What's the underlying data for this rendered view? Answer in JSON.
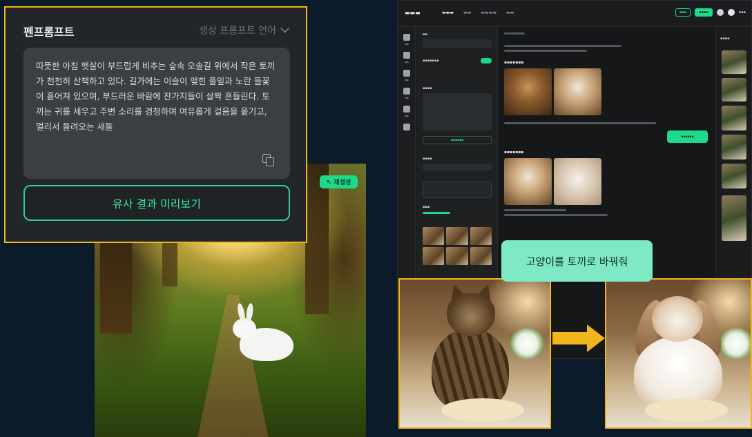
{
  "prompt_panel": {
    "title": "펜프롬프트",
    "dropdown_label": "생성 프롬프트 언어",
    "prompt_text": "따뜻한 아침 햇살이 부드럽게 비추는 숲속 오솔길 위에서 작은 토끼가 천천히 산책하고 있다. 길가에는 이슬이 맺힌 풀잎과 노란 들꽃이 흩어져 있으며, 부드러운 바람에 잔가지들이 살짝 흔들린다. 토끼는 귀를 세우고 주변 소리를 경청하며 여유롭게 걸음을 옮기고, 멀리서 들려오는 새들",
    "preview_button": "유사 결과 미리보기",
    "copy_icon": "copy-icon"
  },
  "forest_image": {
    "badge": "↖ 재생성",
    "accent_color": "#1dd98c"
  },
  "edit_tooltip": "고양이를 토끼로 바꿔줘",
  "colors": {
    "highlight_border": "#f2b51c",
    "accent": "#1dd98c",
    "tooltip_bg": "#7fe9c5",
    "background": "#0c1b29"
  }
}
